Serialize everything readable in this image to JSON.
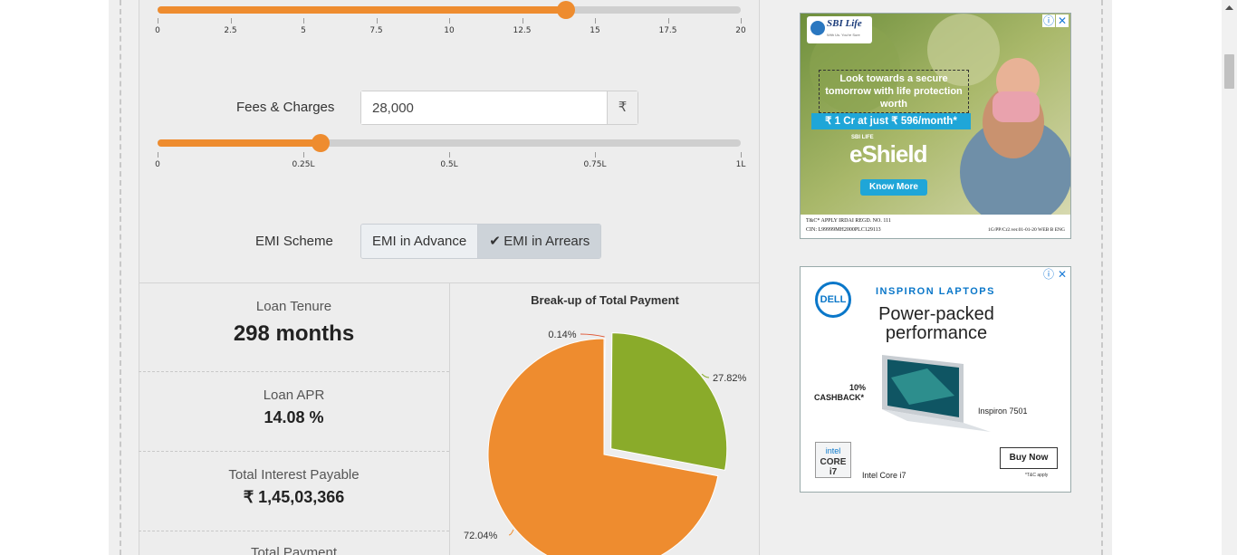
{
  "tenure_slider": {
    "value": 14,
    "min": 0,
    "max": 20,
    "ticks": [
      "0",
      "2.5",
      "5",
      "7.5",
      "10",
      "12.5",
      "15",
      "17.5",
      "20"
    ]
  },
  "fees": {
    "label": "Fees & Charges",
    "value": "28,000",
    "currency": "₹",
    "slider": {
      "value": 0.28,
      "min": 0,
      "max": 1,
      "ticks": [
        "0",
        "0.25L",
        "0.5L",
        "0.75L",
        "1L"
      ]
    }
  },
  "emi_scheme": {
    "label": "EMI Scheme",
    "options": [
      "EMI in Advance",
      "EMI in Arrears"
    ],
    "selected": "EMI in Arrears",
    "check": "✔"
  },
  "results": {
    "loan_tenure": {
      "label": "Loan Tenure",
      "value": "298 months"
    },
    "loan_apr": {
      "label": "Loan APR",
      "value": "14.08 %"
    },
    "total_interest": {
      "label": "Total Interest Payable",
      "value": "₹ 1,45,03,366"
    },
    "total_payment": {
      "label": "Total Payment"
    }
  },
  "chart_data": {
    "type": "pie",
    "title": "Break-up of Total Payment",
    "slices": [
      {
        "label": "0.14%",
        "value": 0.14,
        "color": "#e05b3a"
      },
      {
        "label": "27.82%",
        "value": 27.82,
        "color": "#8aab2a"
      },
      {
        "label": "72.04%",
        "value": 72.04,
        "color": "#ee8c2f"
      }
    ]
  },
  "ad1": {
    "brand": "SBI Life",
    "brand_sub": "With Us. You're Sure",
    "headline": "Look towards a secure tomorrow with life protection worth",
    "offer": "₹ 1 Cr at just ₹ 596/month*",
    "product_prefix": "SBI LIFE",
    "product": "eShield",
    "cta": "Know More",
    "disclaimer1": "T&C* APPLY  IRDAI REGD. NO. 111",
    "disclaimer2": "CIN: L99999MH2000PLC129113",
    "code": "1G/PP/Cr2.ver.01-01-20 WEB B ENG"
  },
  "ad2": {
    "brand": "DELL",
    "tagline": "INSPIRON LAPTOPS",
    "headline": "Power-packed performance",
    "cashback_pct": "10%",
    "cashback_word": "CASHBACK*",
    "model": "Inspiron 7501",
    "chip_line1": "intel",
    "chip_line2": "CORE i7",
    "chip_caption": "Intel Core i7",
    "cta": "Buy Now",
    "tc": "*T&C apply"
  },
  "ad_icons": {
    "info": "ⓘ",
    "close": "✕"
  }
}
